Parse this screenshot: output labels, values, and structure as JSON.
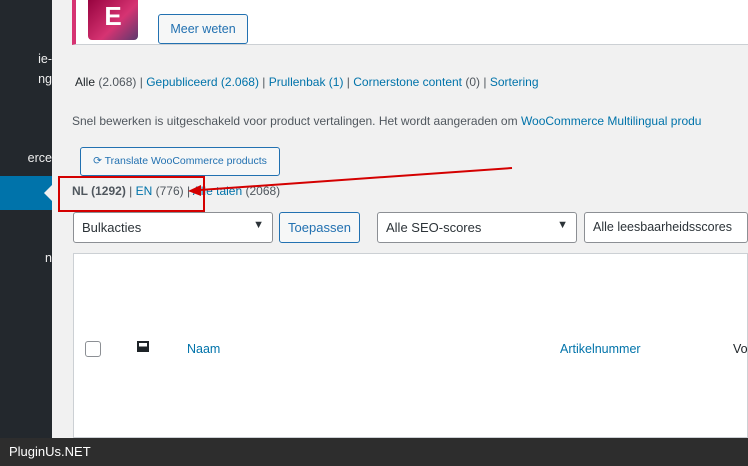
{
  "sidebar": {
    "fragments": [
      "ie-",
      "ng",
      "erce",
      "n"
    ]
  },
  "notice": {
    "logo": "E",
    "button": "Meer weten"
  },
  "status_links": [
    {
      "label": "Alle",
      "count": "(2.068)"
    },
    {
      "label": "Gepubliceerd",
      "count": "(2.068)"
    },
    {
      "label": "Prullenbak",
      "count": "(1)"
    },
    {
      "label": "Cornerstone content",
      "count": "(0)"
    },
    {
      "label": "Sortering",
      "count": ""
    }
  ],
  "info": {
    "text": "Snel bewerken is uitgeschakeld voor product vertalingen. Het wordt aangeraden om",
    "link": "WooCommerce Multilingual produ"
  },
  "translate_button": "Translate WooCommerce products",
  "languages": [
    {
      "label": "NL",
      "count": "(1292)"
    },
    {
      "label": "EN",
      "count": "(776)"
    },
    {
      "label": "Alle talen",
      "count": "(2068)"
    }
  ],
  "filters": {
    "bulk": "Bulkacties",
    "apply": "Toepassen",
    "seo": "Alle SEO-scores",
    "readability": "Alle leesbaarheidsscores"
  },
  "table": {
    "columns": [
      "Naam",
      "Artikelnummer",
      "Vo"
    ]
  },
  "annotation": {
    "color": "#d40000"
  },
  "footer": "PluginUs.NET"
}
